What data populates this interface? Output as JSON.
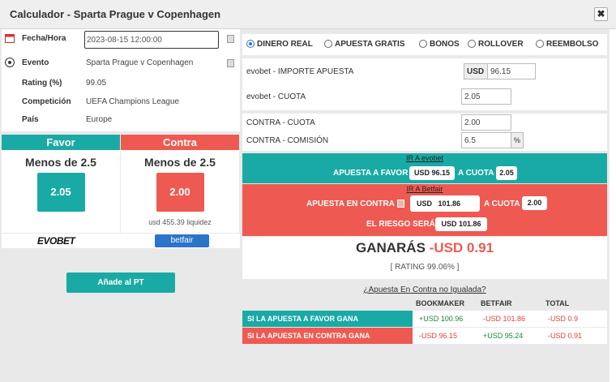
{
  "window": {
    "title": "Calculador - Sparta Prague v Copenhagen",
    "close": "✖"
  },
  "info": {
    "fecha_label": "Fecha/Hora",
    "fecha_value": "2023-08-15 12:00:00",
    "evento_label": "Evento",
    "evento_value": "Sparta Prague v Copenhagen",
    "rating_label": "Rating (%)",
    "rating_value": "99.05",
    "competicion_label": "Competición",
    "competicion_value": "UEFA Champions League",
    "pais_label": "País",
    "pais_value": "Europe"
  },
  "favor": {
    "header": "Favor",
    "market": "Menos de 2.5",
    "odds": "2.05",
    "logo": "EVOBET"
  },
  "contra": {
    "header": "Contra",
    "market": "Menos de 2.5",
    "odds": "2.00",
    "liquidity": "usd 455.39 liquidez",
    "logo": "betfair"
  },
  "add_button": "Añade al PT",
  "modes": [
    "DINERO REAL",
    "APUESTA GRATIS",
    "BONOS",
    "ROLLOVER",
    "REEMBOLSO"
  ],
  "selected_mode": "DINERO REAL",
  "fields": {
    "stake_label": "evobet - IMPORTE APUESTA",
    "stake_currency": "USD",
    "stake_value": "96.15",
    "odds_label": "evobet - CUOTA",
    "odds_value": "2.05",
    "lay_odds_label": "CONTRA - CUOTA",
    "lay_odds_value": "2.00",
    "commission_label": "CONTRA - COMISIÓN",
    "commission_value": "6.5",
    "commission_unit": "%"
  },
  "back": {
    "link": "IR A evobet",
    "label": "APUESTA A FAVOR",
    "amount": "USD 96.15",
    "at_odds": "A CUOTA",
    "odds": "2.05"
  },
  "lay": {
    "link": "IR A Betfair",
    "label": "APUESTA EN CONTRA",
    "currency": "USD",
    "amount": "101.86",
    "at_odds": "A CUOTA",
    "odds": "2.00",
    "risk_label": "EL RIESGO SERÁ",
    "risk": "USD 101.86"
  },
  "result": {
    "prefix": "GANARÁS",
    "amount": "-USD 0.91",
    "rating": "[ RATING 99.06% ]"
  },
  "unmatched_link": "¿Apuesta En Contra no Igualada?",
  "table": {
    "headers": [
      "BOOKMAKER",
      "BETFAIR",
      "TOTAL"
    ],
    "rows": [
      {
        "name": "SI LA APUESTA A FAVOR GANA",
        "bookmaker": "+USD 100.96",
        "betfair": "-USD 101.86",
        "total": "-USD 0.9",
        "color": "#1aaaa5"
      },
      {
        "name": "SI LA APUESTA EN CONTRA GANA",
        "bookmaker": "-USD 96.15",
        "betfair": "+USD 95.24",
        "total": "-USD 0.91",
        "color": "#ee5a52"
      }
    ]
  }
}
